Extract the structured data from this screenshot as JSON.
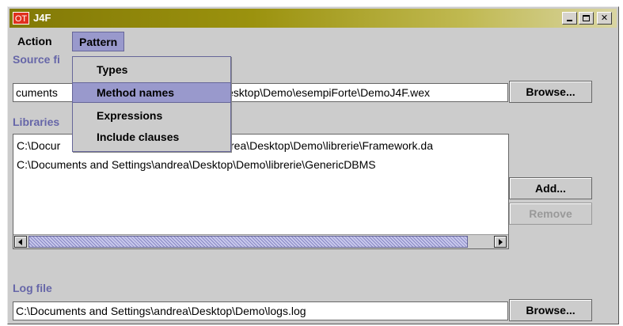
{
  "window": {
    "icon_text": "OT",
    "title": "J4F",
    "controls": {
      "minimize": "_",
      "maximize": "□",
      "close": "✕"
    }
  },
  "menubar": {
    "items": [
      {
        "label": "Action"
      },
      {
        "label": "Pattern",
        "active": true
      }
    ]
  },
  "pattern_menu": {
    "items": [
      {
        "label": "Types"
      },
      {
        "label": "Method names",
        "selected": true
      },
      {
        "label": "Expressions"
      },
      {
        "label": "Include clauses"
      }
    ]
  },
  "source_file": {
    "label": "Source fi",
    "value_left": "cuments",
    "value_right": "esktop\\Demo\\esempiForte\\DemoJ4F.wex",
    "browse_label": "Browse..."
  },
  "libraries": {
    "label": "Libraries",
    "rows": [
      {
        "left": "C:\\Docur",
        "right": "rea\\Desktop\\Demo\\librerie\\Framework.da"
      },
      {
        "full": "C:\\Documents and Settings\\andrea\\Desktop\\Demo\\librerie\\GenericDBMS"
      }
    ],
    "add_label": "Add...",
    "remove_label": "Remove"
  },
  "log_file": {
    "label": "Log file",
    "value": "C:\\Documents and Settings\\andrea\\Desktop\\Demo\\logs.log",
    "browse_label": "Browse..."
  },
  "colors": {
    "title_gradient_start": "#827906",
    "title_gradient_end": "#d9d5a2",
    "section_label": "#6666a8",
    "menu_highlight": "#9999cc",
    "window_background": "#cccccc"
  }
}
